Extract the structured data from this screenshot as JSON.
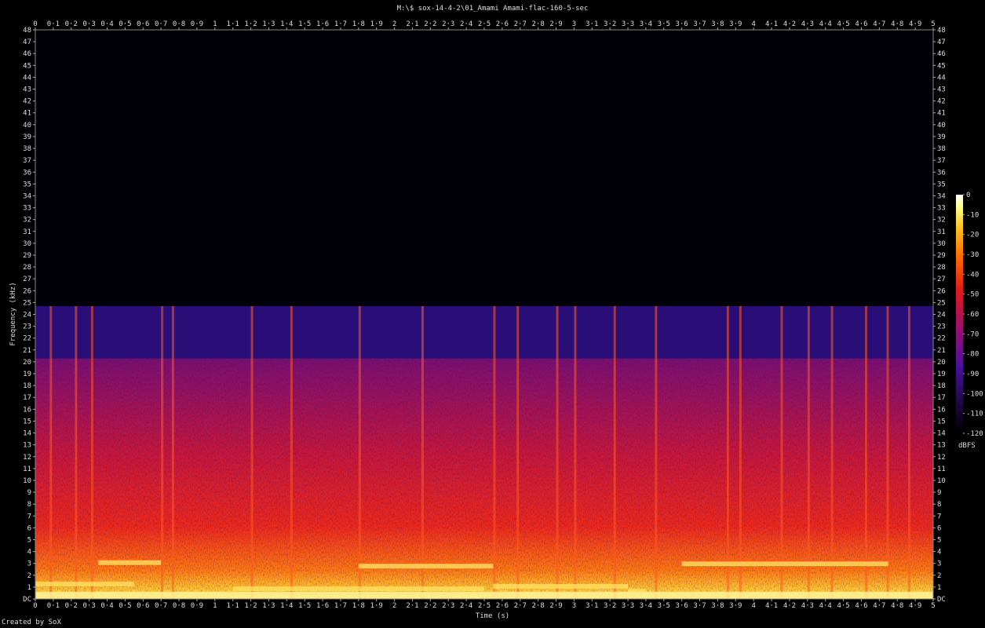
{
  "chart_data": {
    "type": "heatmap",
    "title": "M:\\$ sox-14-4-2\\01_Amami Amami-flac-160-5-sec",
    "xlabel": "Time (s)",
    "ylabel": "Frequency (kHz)",
    "credit": "Created by SoX",
    "colorbar_label": "dBFS",
    "xlim": [
      0,
      5
    ],
    "ylim": [
      0,
      48
    ],
    "x_ticks": [
      "0",
      "0·1",
      "0·2",
      "0·3",
      "0·4",
      "0·5",
      "0·6",
      "0·7",
      "0·8",
      "0·9",
      "1",
      "1·1",
      "1·2",
      "1·3",
      "1·4",
      "1·5",
      "1·6",
      "1·7",
      "1·8",
      "1·9",
      "2",
      "2·1",
      "2·2",
      "2·3",
      "2·4",
      "2·5",
      "2·6",
      "2·7",
      "2·8",
      "2·9",
      "3",
      "3·1",
      "3·2",
      "3·3",
      "3·4",
      "3·5",
      "3·6",
      "3·7",
      "3·8",
      "3·9",
      "4",
      "4·1",
      "4·2",
      "4·3",
      "4·4",
      "4·5",
      "4·6",
      "4·7",
      "4·8",
      "4·9",
      "5"
    ],
    "y_ticks": [
      "DC",
      "1",
      "2",
      "3",
      "4",
      "5",
      "6",
      "7",
      "8",
      "9",
      "10",
      "11",
      "12",
      "13",
      "14",
      "15",
      "16",
      "17",
      "18",
      "19",
      "20",
      "21",
      "22",
      "23",
      "24",
      "25",
      "26",
      "27",
      "28",
      "29",
      "30",
      "31",
      "32",
      "33",
      "34",
      "35",
      "36",
      "37",
      "38",
      "39",
      "40",
      "41",
      "42",
      "43",
      "44",
      "45",
      "46",
      "47",
      "48"
    ],
    "colorbar_ticks": [
      "0",
      "-10",
      "-20",
      "-30",
      "-40",
      "-50",
      "-60",
      "-70",
      "-80",
      "-90",
      "-100",
      "-110",
      "-120"
    ],
    "colorbar_range": [
      -120,
      0
    ],
    "lowpass_cutoff_khz": 20.3,
    "noise_band_top_khz": 24.7,
    "colors": [
      "#000000",
      "#1a0840",
      "#4a10a0",
      "#a0106a",
      "#e01a1a",
      "#ff6a00",
      "#ffc020",
      "#ffff90",
      "#ffffff"
    ]
  }
}
